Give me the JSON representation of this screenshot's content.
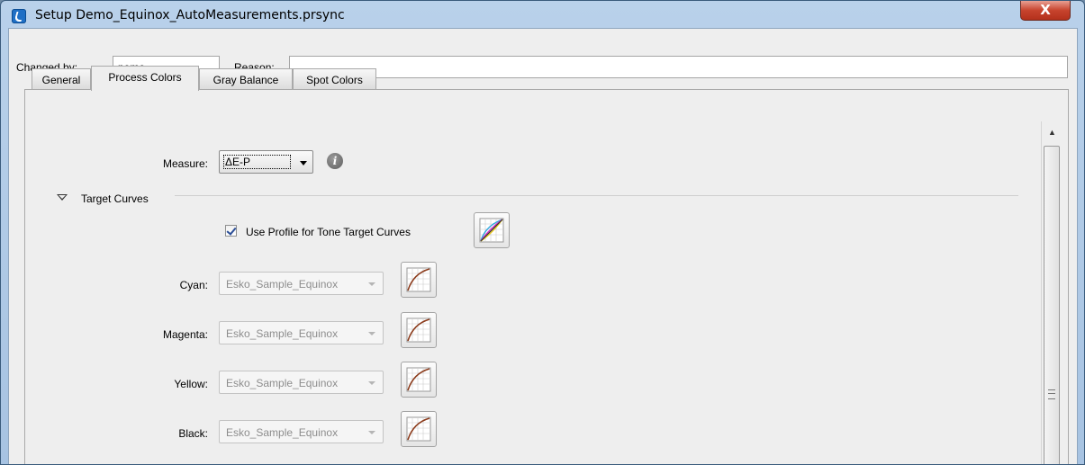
{
  "window": {
    "title": "Setup Demo_Equinox_AutoMeasurements.prsync",
    "close_glyph": "X"
  },
  "header": {
    "changed_by_label": "Changed by:",
    "changed_by_value": "pemo",
    "reason_label": "Reason:",
    "reason_value": ""
  },
  "tabs": [
    {
      "label": "General",
      "active": false
    },
    {
      "label": "Process Colors",
      "active": true
    },
    {
      "label": "Gray Balance",
      "active": false
    },
    {
      "label": "Spot Colors",
      "active": false
    }
  ],
  "measure": {
    "label": "Measure:",
    "value": "ΔE-P",
    "info_icon": "i"
  },
  "target_curves": {
    "section_label": "Target Curves",
    "expanded": true,
    "use_profile_label": "Use Profile for Tone Target Curves",
    "use_profile_checked": true,
    "rows": [
      {
        "label": "Cyan:",
        "value": "Esko_Sample_Equinox",
        "icon": "curve-icon"
      },
      {
        "label": "Magenta:",
        "value": "Esko_Sample_Equinox",
        "icon": "curve-icon"
      },
      {
        "label": "Yellow:",
        "value": "Esko_Sample_Equinox",
        "icon": "curve-icon"
      },
      {
        "label": "Black:",
        "value": "Esko_Sample_Equinox",
        "icon": "curve-icon"
      }
    ]
  },
  "icons": {
    "app": "app-logo-icon",
    "info": "info-icon",
    "expand": "triangle-down-icon",
    "profile_curves": "profile-curves-icon",
    "curve": "curve-icon"
  },
  "colors": {
    "title_bar": "#b9d1ea",
    "close_button": "#c7442e",
    "client_bg": "#eeeeee",
    "curve_line": "#8b3a1a"
  }
}
